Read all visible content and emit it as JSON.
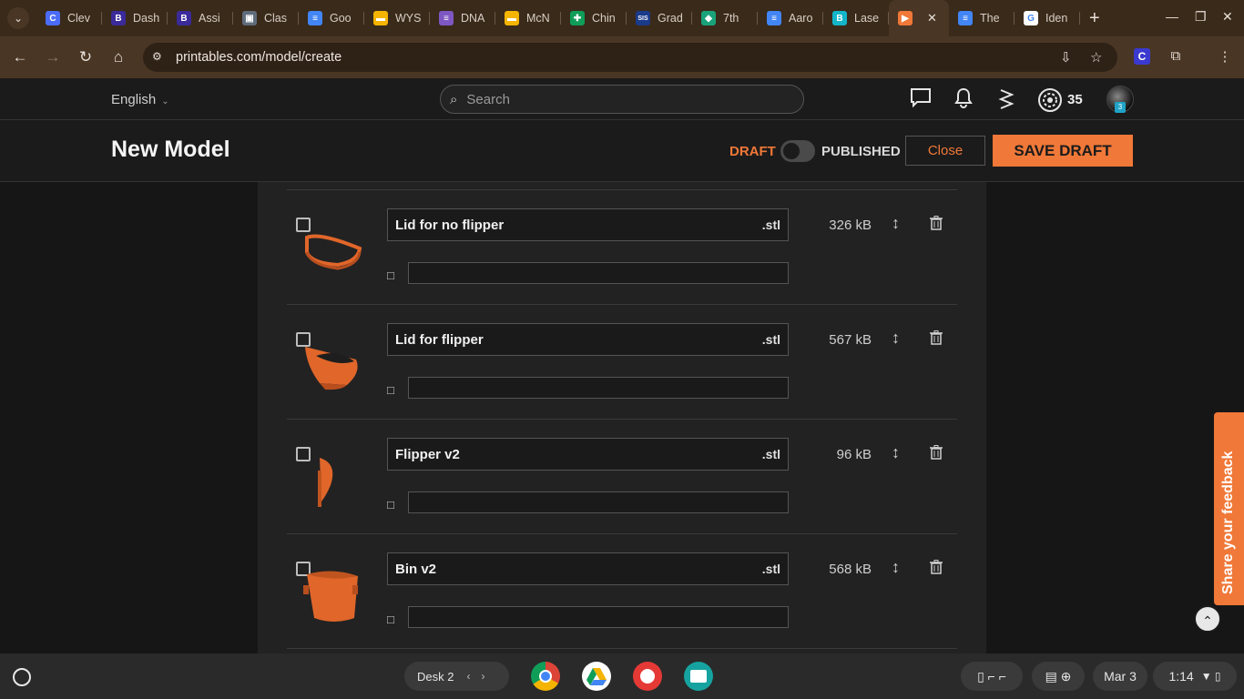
{
  "tabs": [
    {
      "label": "Clev",
      "fav": "C",
      "color": "#4a6cf7"
    },
    {
      "label": "Dash",
      "fav": "B",
      "color": "#3a2a9a"
    },
    {
      "label": "Assi",
      "fav": "B",
      "color": "#3a2a9a"
    },
    {
      "label": "Clas",
      "fav": "▣",
      "color": "#5f6c7b"
    },
    {
      "label": "Goo",
      "fav": "≡",
      "color": "#4285f4"
    },
    {
      "label": "WYS",
      "fav": "▬",
      "color": "#f4b400"
    },
    {
      "label": "DNA",
      "fav": "≡",
      "color": "#7e57c2"
    },
    {
      "label": "McN",
      "fav": "▬",
      "color": "#f4b400"
    },
    {
      "label": "Chin",
      "fav": "✚",
      "color": "#0f9d58"
    },
    {
      "label": "Grad",
      "fav": "SIS",
      "color": "#1a3a8a"
    },
    {
      "label": "7th",
      "fav": "◆",
      "color": "#1aa37a"
    },
    {
      "label": "Aaro",
      "fav": "≡",
      "color": "#4285f4"
    },
    {
      "label": "Lase",
      "fav": "B",
      "color": "#13b5c9"
    }
  ],
  "active_tab": {
    "label": "",
    "fav": "▶",
    "color": "#f07838"
  },
  "tabs_after": [
    {
      "label": "The",
      "fav": "≡",
      "color": "#4285f4"
    },
    {
      "label": "Iden",
      "fav": "G",
      "color": "#ffffff"
    }
  ],
  "url": "printables.com/model/create",
  "header": {
    "language": "English",
    "search_placeholder": "Search",
    "points": "35",
    "avatar_badge": "3"
  },
  "titlebar": {
    "title": "New Model",
    "draft_label": "DRAFT",
    "published_label": "PUBLISHED",
    "close_label": "Close",
    "save_label": "SAVE DRAFT"
  },
  "files": [
    {
      "name": "Lid for no flipper",
      "ext": ".stl",
      "size": "326 kB",
      "shape": "ring"
    },
    {
      "name": "Lid for flipper",
      "ext": ".stl",
      "size": "567 kB",
      "shape": "tray"
    },
    {
      "name": "Flipper v2",
      "ext": ".stl",
      "size": "96 kB",
      "shape": "flipper"
    },
    {
      "name": "Bin v2",
      "ext": ".stl",
      "size": "568 kB",
      "shape": "bin"
    }
  ],
  "feedback_label": "Share your feedback",
  "shelf": {
    "desk": "Desk 2",
    "date": "Mar 3",
    "time": "1:14"
  },
  "colors": {
    "accent": "#f07838",
    "chrome": "#4a3624"
  }
}
